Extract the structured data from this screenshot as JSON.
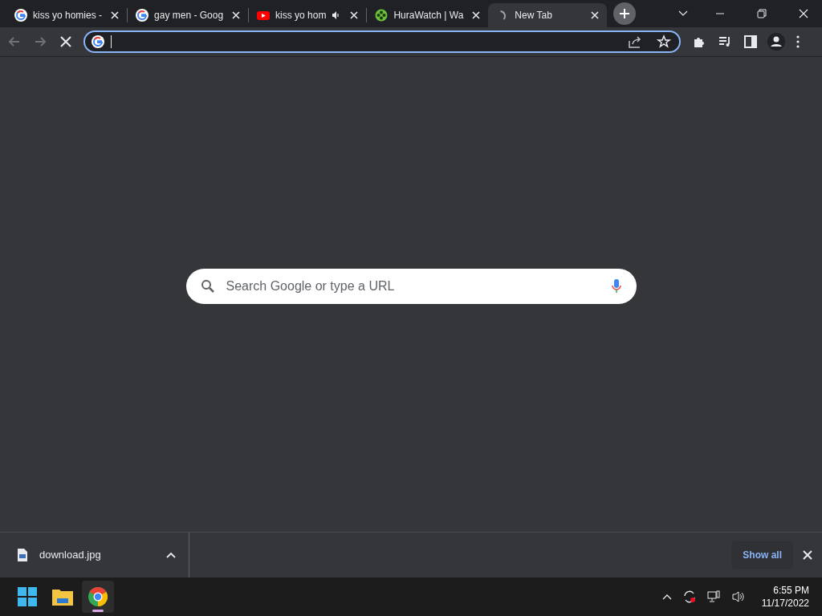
{
  "tabs": [
    {
      "kind": "google",
      "title": "kiss yo homies -",
      "audio": false,
      "selected": false
    },
    {
      "kind": "google",
      "title": "gay men - Goog",
      "audio": false,
      "selected": false
    },
    {
      "kind": "youtube",
      "title": "kiss yo hom",
      "audio": true,
      "selected": false
    },
    {
      "kind": "reel",
      "title": "HuraWatch | Wa",
      "audio": false,
      "selected": false
    },
    {
      "kind": "loading",
      "title": "New Tab",
      "audio": false,
      "selected": true
    }
  ],
  "omnibox": {
    "focused": true
  },
  "search": {
    "placeholder": "Search Google or type a URL"
  },
  "downloads": {
    "items": [
      {
        "name": "download.jpg"
      }
    ],
    "show_all": "Show all"
  },
  "taskbar": {
    "apps": [
      {
        "kind": "start",
        "active": false
      },
      {
        "kind": "files",
        "active": false
      },
      {
        "kind": "chrome",
        "active": true
      }
    ],
    "time": "6:55 PM",
    "date": "11/17/2022"
  }
}
